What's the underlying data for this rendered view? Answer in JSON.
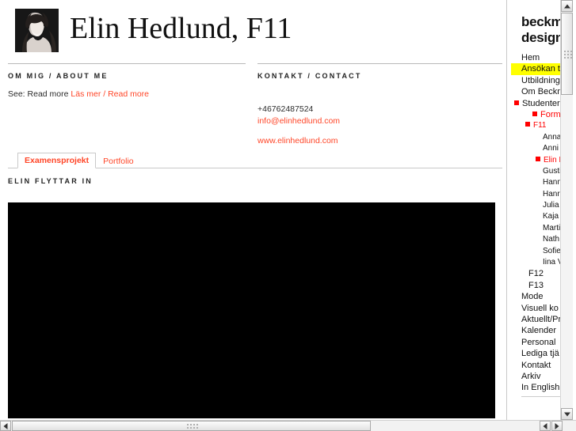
{
  "header": {
    "title": "Elin Hedlund, F11",
    "photo_alt": "portrait-photo"
  },
  "about": {
    "section_title": "OM MIG / ABOUT ME",
    "text_prefix": "See: Read more ",
    "link_text": "Läs mer / Read more"
  },
  "contact": {
    "section_title": "KONTAKT / CONTACT",
    "phone": "+46762487524",
    "email": "info@elinhedlund.com",
    "website": "www.elinhedlund.com"
  },
  "tabs": [
    {
      "label": "Examensprojekt",
      "active": true
    },
    {
      "label": "Portfolio",
      "active": false
    }
  ],
  "project": {
    "title": "ELIN FLYTTAR IN"
  },
  "sidebar": {
    "logo_line1": "beckm",
    "logo_line2": "design",
    "items": [
      {
        "label": "Hem",
        "level": 0,
        "bullet": false,
        "red": false,
        "highlight": false
      },
      {
        "label": "Ansökan t",
        "level": 0,
        "bullet": false,
        "red": false,
        "highlight": true
      },
      {
        "label": "Utbildning",
        "level": 0,
        "bullet": false,
        "red": false,
        "highlight": false
      },
      {
        "label": "Om Beckm",
        "level": 0,
        "bullet": false,
        "red": false,
        "highlight": false
      },
      {
        "label": "Studenter",
        "level": 0,
        "bullet": true,
        "red": false,
        "highlight": false
      },
      {
        "label": "Form",
        "level": 1,
        "bullet": true,
        "red": true,
        "highlight": false
      },
      {
        "label": "F11",
        "level": 2,
        "bullet": true,
        "red": true,
        "highlight": false
      },
      {
        "label": "Anna",
        "level": 3,
        "bullet": false,
        "red": false,
        "highlight": false
      },
      {
        "label": "Anni",
        "level": 3,
        "bullet": false,
        "red": false,
        "highlight": false
      },
      {
        "label": "Elin H",
        "level": 3,
        "bullet": true,
        "red": true,
        "highlight": false
      },
      {
        "label": "Gusti",
        "level": 3,
        "bullet": false,
        "red": false,
        "highlight": false
      },
      {
        "label": "Hann",
        "level": 3,
        "bullet": false,
        "red": false,
        "highlight": false
      },
      {
        "label": "Hanr",
        "level": 3,
        "bullet": false,
        "red": false,
        "highlight": false
      },
      {
        "label": "Julia",
        "level": 3,
        "bullet": false,
        "red": false,
        "highlight": false
      },
      {
        "label": "Kaja",
        "level": 3,
        "bullet": false,
        "red": false,
        "highlight": false
      },
      {
        "label": "Marti",
        "level": 3,
        "bullet": false,
        "red": false,
        "highlight": false
      },
      {
        "label": "Nath",
        "level": 3,
        "bullet": false,
        "red": false,
        "highlight": false
      },
      {
        "label": "Sofie",
        "level": 3,
        "bullet": false,
        "red": false,
        "highlight": false
      },
      {
        "label": "Iina V",
        "level": 3,
        "bullet": false,
        "red": false,
        "highlight": false
      },
      {
        "label": "F12",
        "level": 2,
        "bullet": false,
        "red": false,
        "highlight": false
      },
      {
        "label": "F13",
        "level": 2,
        "bullet": false,
        "red": false,
        "highlight": false
      },
      {
        "label": "Mode",
        "level": 1,
        "bullet": false,
        "red": false,
        "highlight": false
      },
      {
        "label": "Visuell ko",
        "level": 1,
        "bullet": false,
        "red": false,
        "highlight": false
      },
      {
        "label": "Aktuellt/Pr",
        "level": 0,
        "bullet": false,
        "red": false,
        "highlight": false
      },
      {
        "label": "Kalender",
        "level": 0,
        "bullet": false,
        "red": false,
        "highlight": false
      },
      {
        "label": "Personal",
        "level": 0,
        "bullet": false,
        "red": false,
        "highlight": false
      },
      {
        "label": "Lediga tjä",
        "level": 0,
        "bullet": false,
        "red": false,
        "highlight": false
      },
      {
        "label": "Kontakt",
        "level": 0,
        "bullet": false,
        "red": false,
        "highlight": false
      },
      {
        "label": "Arkiv",
        "level": 0,
        "bullet": false,
        "red": false,
        "highlight": false
      },
      {
        "label": "In English",
        "level": 0,
        "bullet": false,
        "red": false,
        "highlight": false
      }
    ]
  },
  "colors": {
    "accent_link": "#ff4628",
    "nav_red": "#ff0000",
    "highlight": "#ffff00",
    "media_bg": "#000000",
    "rule": "#b8b8b8"
  },
  "scrollbars": {
    "up_arrow": "scroll-up-arrow",
    "down_arrow": "scroll-down-arrow",
    "left_arrow": "scroll-left-arrow",
    "right_arrow": "scroll-right-arrow"
  }
}
